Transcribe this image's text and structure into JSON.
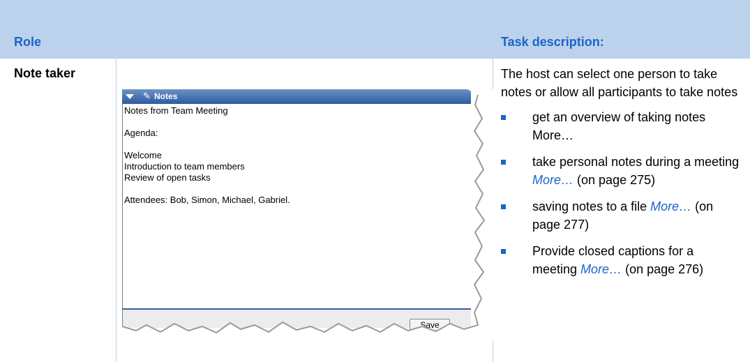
{
  "table": {
    "header": {
      "role": "Role",
      "task": "Task description:"
    },
    "row": {
      "role": "Note taker",
      "intro": "The host can select one person to take notes or allow all participants to take notes",
      "tasks": [
        {
          "text": "get an overview of taking notes More…",
          "link": "",
          "page_ref": ""
        },
        {
          "text": "take personal notes during a meeting",
          "link": "More…",
          "page_ref": "(on page 275)"
        },
        {
          "text": "saving notes to a file",
          "link": "More…",
          "page_ref": "(on page 277)"
        },
        {
          "text": "Provide closed captions for a meeting",
          "link": "More…",
          "page_ref": "(on page 276)"
        }
      ]
    }
  },
  "notes_panel": {
    "title": "Notes",
    "lines": [
      "Notes from Team Meeting",
      "",
      "Agenda:",
      "",
      "Welcome",
      "Introduction to team members",
      "Review of open tasks",
      "",
      "Attendees: Bob, Simon, Michael, Gabriel."
    ],
    "save_label": "Save"
  },
  "colors": {
    "header_bg": "#bcd2ec",
    "header_text": "#1b65c7",
    "link": "#1b65c7",
    "notes_titlebar": "#2b5ba1"
  }
}
